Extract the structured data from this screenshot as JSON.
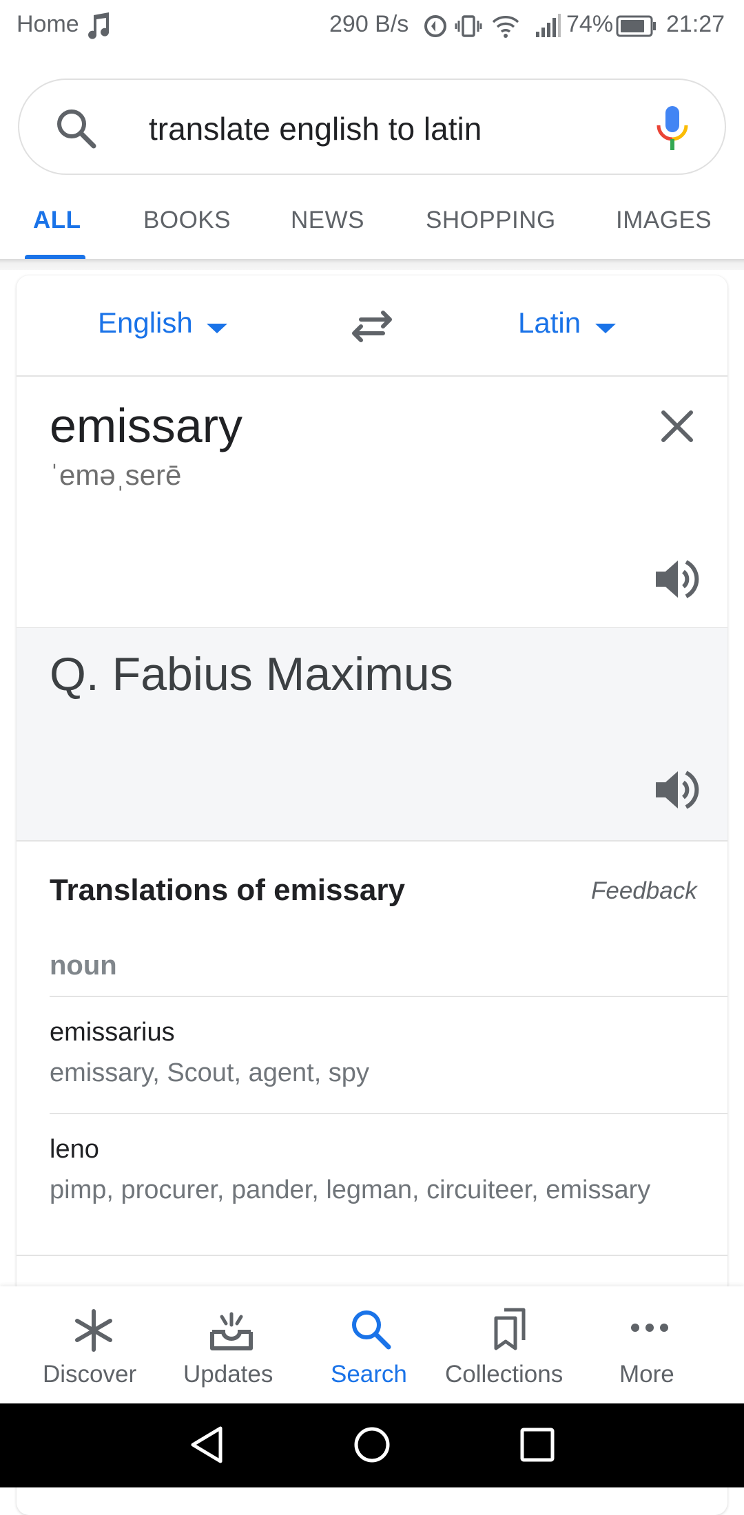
{
  "status_bar": {
    "left_text": "Home",
    "speed": "290 B/s",
    "battery": "74%",
    "time": "21:27",
    "icons": [
      "music-note-icon",
      "data-saver-icon",
      "vibrate-icon",
      "wifi-icon",
      "signal-icon",
      "battery-icon"
    ]
  },
  "search": {
    "query": "translate english to latin",
    "icons": [
      "search-icon",
      "mic-icon"
    ]
  },
  "tabs": [
    {
      "label": "ALL",
      "active": true
    },
    {
      "label": "BOOKS"
    },
    {
      "label": "NEWS"
    },
    {
      "label": "SHOPPING"
    },
    {
      "label": "IMAGES"
    }
  ],
  "translator": {
    "source_lang": "English",
    "target_lang": "Latin",
    "source_word": "emissary",
    "phonetic": "ˈeməˌserē",
    "target_text": "Q. Fabius Maximus",
    "translations_title": "Translations of emissary",
    "feedback_label": "Feedback",
    "part_of_speech": "noun",
    "entries": [
      {
        "word": "emissarius",
        "synonyms": "emissary, Scout, agent, spy"
      },
      {
        "word": "leno",
        "synonyms": "pimp, procurer, pander, legman, circuiteer, emissary"
      }
    ]
  },
  "bottom_nav": [
    {
      "label": "Discover",
      "icon": "asterisk-icon"
    },
    {
      "label": "Updates",
      "icon": "inbox-icon"
    },
    {
      "label": "Search",
      "icon": "search-icon",
      "active": true
    },
    {
      "label": "Collections",
      "icon": "bookmarks-icon"
    },
    {
      "label": "More",
      "icon": "more-icon"
    }
  ],
  "colors": {
    "accent": "#1a73e8",
    "text_primary": "#202124",
    "text_secondary": "#5f6368",
    "target_panel_bg": "#f5f6f8"
  }
}
